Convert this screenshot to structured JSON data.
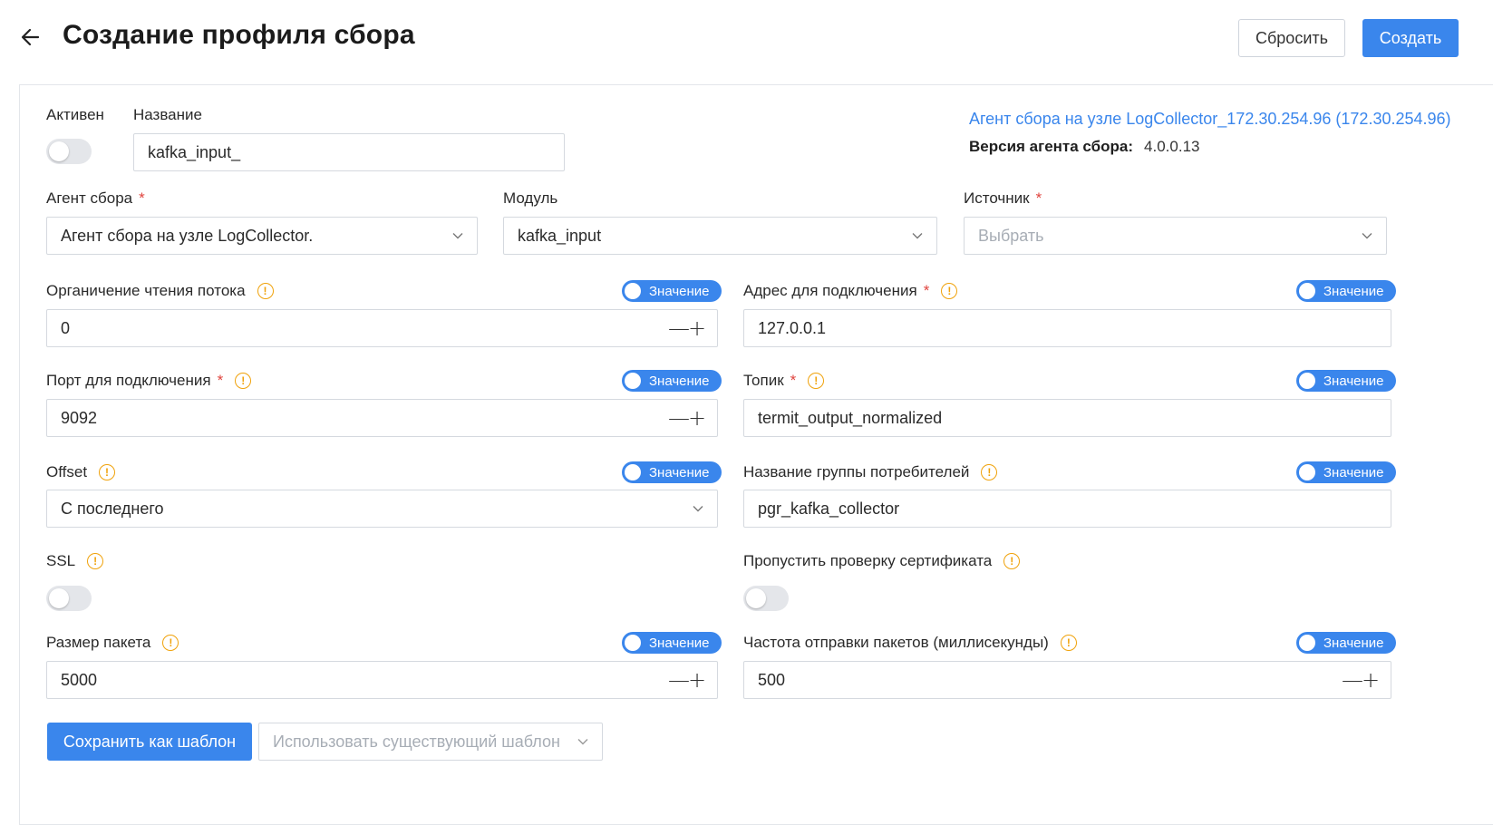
{
  "header": {
    "title": "Создание профиля сбора",
    "reset_label": "Сбросить",
    "create_label": "Создать"
  },
  "colors": {
    "accent": "#3a86ec",
    "required": "#e0443e",
    "info": "#f0a20b"
  },
  "agent_info": {
    "link": "Агент сбора на узле LogCollector_172.30.254.96 (172.30.254.96)",
    "version_label": "Версия агента сбора:",
    "version_value": "4.0.0.13"
  },
  "form": {
    "active_label": "Активен",
    "active_on": false,
    "name_label": "Название",
    "name_value": "kafka_input_",
    "agent_label": "Агент сбора",
    "agent_value": "Агент сбора на узле LogCollector.",
    "module_label": "Модуль",
    "module_value": "kafka_input",
    "source_label": "Источник",
    "source_placeholder": "Выбрать",
    "value_toggle_label": "Значение",
    "thread_limit_label": "Органичение чтения потока",
    "thread_limit_value": "0",
    "address_label": "Адрес для подключения",
    "address_value": "127.0.0.1",
    "port_label": "Порт для подключения",
    "port_value": "9092",
    "topic_label": "Топик",
    "topic_value": "termit_output_normalized",
    "offset_label": "Offset",
    "offset_value": "С последнего",
    "consumer_group_label": "Название группы потребителей",
    "consumer_group_value": "pgr_kafka_collector",
    "ssl_label": "SSL",
    "ssl_on": false,
    "skip_cert_label": "Пропустить проверку сертификата",
    "skip_cert_on": false,
    "batch_size_label": "Размер пакета",
    "batch_size_value": "5000",
    "send_freq_label": "Частота отправки пакетов (миллисекунды)",
    "send_freq_value": "500",
    "stepper_minus": "—",
    "stepper_plus": "+"
  },
  "footer": {
    "save_template_label": "Сохранить как шаблон",
    "use_template_placeholder": "Использовать существующий шаблон"
  }
}
